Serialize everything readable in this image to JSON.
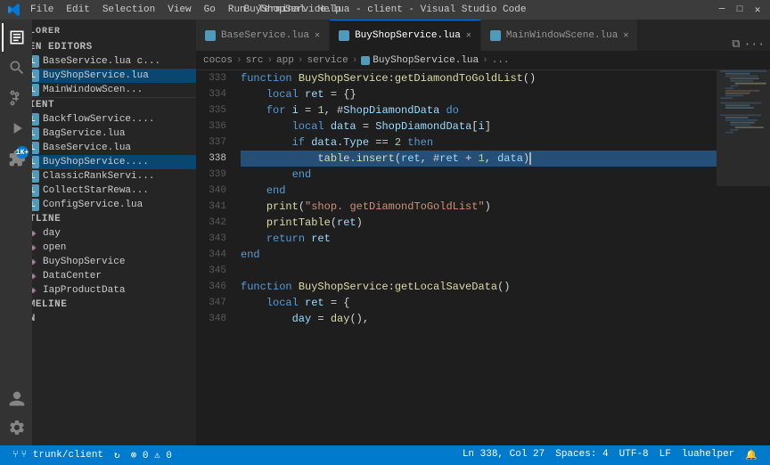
{
  "titleBar": {
    "title": "BuyShopService.lua - client - Visual Studio Code",
    "menuItems": [
      "File",
      "Edit",
      "Selection",
      "View",
      "Go",
      "Run",
      "Terminal",
      "Help"
    ],
    "windowButtons": [
      "─",
      "□",
      "✕"
    ]
  },
  "activityBar": {
    "icons": [
      {
        "name": "explorer-icon",
        "symbol": "⎘",
        "active": true
      },
      {
        "name": "search-icon",
        "symbol": "🔍",
        "active": false
      },
      {
        "name": "source-control-icon",
        "symbol": "⑂",
        "active": false
      },
      {
        "name": "run-icon",
        "symbol": "▶",
        "active": false
      },
      {
        "name": "extensions-icon",
        "symbol": "⊞",
        "active": false
      }
    ],
    "bottomIcons": [
      {
        "name": "account-icon",
        "symbol": "👤"
      },
      {
        "name": "settings-icon",
        "symbol": "⚙"
      }
    ],
    "badge": "1K+"
  },
  "sidebar": {
    "title": "EXPLORER",
    "sections": {
      "openEditors": {
        "label": "OPEN EDITORS",
        "items": [
          {
            "name": "BaseService.lua",
            "label": "BaseService.lua  c...",
            "modified": false,
            "active": false
          },
          {
            "name": "BuyShopService.lua",
            "label": "BuyShopService.lua",
            "modified": true,
            "active": true
          },
          {
            "name": "MainWindowScene.lua",
            "label": "MainWindowScen...",
            "modified": false,
            "active": false
          }
        ]
      },
      "client": {
        "label": "CLIENT",
        "items": [
          {
            "name": "BackflowService",
            "label": "BackflowService...."
          },
          {
            "name": "BagService",
            "label": "BagService.lua"
          },
          {
            "name": "BaseService",
            "label": "BaseService.lua"
          },
          {
            "name": "BuyShopService",
            "label": "BuyShopService...."
          },
          {
            "name": "ClassicRankServi",
            "label": "ClassicRankServi..."
          },
          {
            "name": "CollectStarRewa",
            "label": "CollectStarRewa..."
          },
          {
            "name": "ConfigService",
            "label": "ConfigService.lua"
          }
        ]
      },
      "outline": {
        "label": "OUTLINE",
        "items": [
          {
            "name": "day",
            "label": "day"
          },
          {
            "name": "open",
            "label": "open"
          },
          {
            "name": "BuyShopService",
            "label": "BuyShopService"
          },
          {
            "name": "DataCenter",
            "label": "DataCenter"
          },
          {
            "name": "IapProductData",
            "label": "IapProductData"
          }
        ]
      },
      "timeline": {
        "label": "TIMELINE",
        "collapsed": true
      },
      "svn": {
        "label": "SVN",
        "collapsed": true
      }
    }
  },
  "tabs": [
    {
      "label": "BaseService.lua",
      "active": false,
      "modified": false
    },
    {
      "label": "BuyShopService.lua",
      "active": true,
      "modified": true
    },
    {
      "label": "MainWindowScene.lua",
      "active": false,
      "modified": false
    }
  ],
  "breadcrumb": {
    "parts": [
      "cocos",
      "src",
      "app",
      "service",
      "BuyShopService.lua",
      "..."
    ]
  },
  "editor": {
    "lines": [
      {
        "num": 333,
        "tokens": [
          {
            "t": "kw",
            "v": "function"
          },
          {
            "t": "plain",
            "v": " "
          },
          {
            "t": "fn",
            "v": "BuyShopService:getDiamondToGoldList"
          },
          {
            "t": "punct",
            "v": "()"
          }
        ]
      },
      {
        "num": 334,
        "tokens": [
          {
            "t": "plain",
            "v": "    "
          },
          {
            "t": "kw",
            "v": "local"
          },
          {
            "t": "plain",
            "v": " "
          },
          {
            "t": "var",
            "v": "ret"
          },
          {
            "t": "plain",
            "v": " = {}"
          }
        ]
      },
      {
        "num": 335,
        "tokens": [
          {
            "t": "plain",
            "v": "    "
          },
          {
            "t": "kw",
            "v": "for"
          },
          {
            "t": "plain",
            "v": " "
          },
          {
            "t": "var",
            "v": "i"
          },
          {
            "t": "plain",
            "v": " = "
          },
          {
            "t": "num",
            "v": "1"
          },
          {
            "t": "plain",
            "v": ", #"
          },
          {
            "t": "var",
            "v": "ShopDiamondData"
          },
          {
            "t": "plain",
            "v": " "
          },
          {
            "t": "kw",
            "v": "do"
          }
        ]
      },
      {
        "num": 336,
        "tokens": [
          {
            "t": "plain",
            "v": "        "
          },
          {
            "t": "kw",
            "v": "local"
          },
          {
            "t": "plain",
            "v": " "
          },
          {
            "t": "var",
            "v": "data"
          },
          {
            "t": "plain",
            "v": " = "
          },
          {
            "t": "var",
            "v": "ShopDiamondData"
          },
          {
            "t": "punct",
            "v": "["
          },
          {
            "t": "var",
            "v": "i"
          },
          {
            "t": "punct",
            "v": "]"
          }
        ]
      },
      {
        "num": 337,
        "tokens": [
          {
            "t": "plain",
            "v": "        "
          },
          {
            "t": "kw",
            "v": "if"
          },
          {
            "t": "plain",
            "v": " "
          },
          {
            "t": "var",
            "v": "data"
          },
          {
            "t": "plain",
            "v": "."
          },
          {
            "t": "var",
            "v": "Type"
          },
          {
            "t": "plain",
            "v": " == "
          },
          {
            "t": "num",
            "v": "2"
          },
          {
            "t": "plain",
            "v": " "
          },
          {
            "t": "kw",
            "v": "then"
          }
        ]
      },
      {
        "num": 338,
        "tokens": [
          {
            "t": "plain",
            "v": "            "
          },
          {
            "t": "fn",
            "v": "table.insert"
          },
          {
            "t": "punct",
            "v": "("
          },
          {
            "t": "var",
            "v": "ret"
          },
          {
            "t": "plain",
            "v": ", #"
          },
          {
            "t": "var",
            "v": "ret"
          },
          {
            "t": "plain",
            "v": " + "
          },
          {
            "t": "num",
            "v": "1"
          },
          {
            "t": "plain",
            "v": ", "
          },
          {
            "t": "var",
            "v": "data"
          },
          {
            "t": "punct",
            "v": ")"
          }
        ],
        "highlighted": true
      },
      {
        "num": 339,
        "tokens": [
          {
            "t": "plain",
            "v": "        "
          },
          {
            "t": "kw",
            "v": "end"
          }
        ]
      },
      {
        "num": 340,
        "tokens": [
          {
            "t": "plain",
            "v": "    "
          },
          {
            "t": "kw",
            "v": "end"
          }
        ]
      },
      {
        "num": 341,
        "tokens": [
          {
            "t": "plain",
            "v": "    "
          },
          {
            "t": "fn",
            "v": "print"
          },
          {
            "t": "plain",
            "v": "("
          },
          {
            "t": "str",
            "v": "\"shop. getDiamondToGoldList\""
          },
          {
            "t": "plain",
            "v": ")"
          }
        ]
      },
      {
        "num": 342,
        "tokens": [
          {
            "t": "plain",
            "v": "    "
          },
          {
            "t": "fn",
            "v": "printTable"
          },
          {
            "t": "plain",
            "v": "("
          },
          {
            "t": "var",
            "v": "ret"
          },
          {
            "t": "plain",
            "v": ")"
          }
        ]
      },
      {
        "num": 343,
        "tokens": [
          {
            "t": "plain",
            "v": "    "
          },
          {
            "t": "kw",
            "v": "return"
          },
          {
            "t": "plain",
            "v": " "
          },
          {
            "t": "var",
            "v": "ret"
          }
        ]
      },
      {
        "num": 344,
        "tokens": [
          {
            "t": "kw",
            "v": "end"
          }
        ]
      },
      {
        "num": 345,
        "tokens": []
      },
      {
        "num": 346,
        "tokens": [
          {
            "t": "kw",
            "v": "function"
          },
          {
            "t": "plain",
            "v": " "
          },
          {
            "t": "fn",
            "v": "BuyShopService:getLocalSaveData"
          },
          {
            "t": "punct",
            "v": "()"
          }
        ]
      },
      {
        "num": 347,
        "tokens": [
          {
            "t": "plain",
            "v": "    "
          },
          {
            "t": "kw",
            "v": "local"
          },
          {
            "t": "plain",
            "v": " "
          },
          {
            "t": "var",
            "v": "ret"
          },
          {
            "t": "plain",
            "v": " = {"
          }
        ]
      },
      {
        "num": 348,
        "tokens": [
          {
            "t": "plain",
            "v": "        "
          },
          {
            "t": "var",
            "v": "day"
          },
          {
            "t": "plain",
            "v": " = "
          },
          {
            "t": "fn",
            "v": "day"
          },
          {
            "t": "plain",
            "v": "(),"
          }
        ]
      }
    ],
    "cursorLine": 338,
    "cursorCol": 27
  },
  "statusBar": {
    "left": [
      {
        "label": "⑂ trunk/client",
        "icon": "branch-icon"
      },
      {
        "label": "↻",
        "icon": "sync-icon"
      },
      {
        "label": "⊗ 0  ⚠ 0",
        "icon": "errors-icon"
      }
    ],
    "right": [
      {
        "label": "Ln 338, Col 27"
      },
      {
        "label": "Spaces: 4"
      },
      {
        "label": "UTF-8"
      },
      {
        "label": "LF"
      },
      {
        "label": "luahelper"
      },
      {
        "label": "🔔"
      }
    ]
  }
}
